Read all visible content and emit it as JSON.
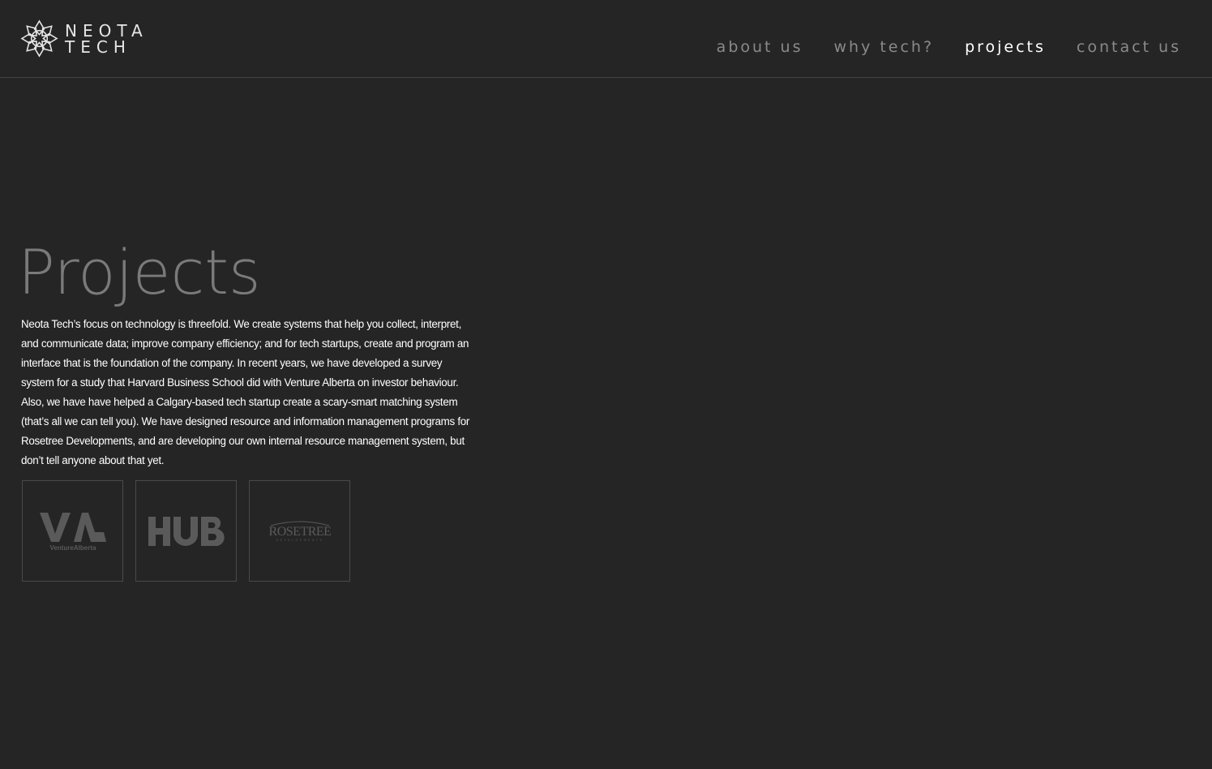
{
  "brand": {
    "name_line1": "NEOTA",
    "name_line2": "TECH"
  },
  "nav": {
    "items": [
      {
        "label": "about us",
        "active": false
      },
      {
        "label": "why tech?",
        "active": false
      },
      {
        "label": "projects",
        "active": true
      },
      {
        "label": "contact us",
        "active": false
      }
    ]
  },
  "main": {
    "title": "Projects",
    "intro": "Neota Tech’s focus on technology is threefold. We create systems that help you collect, interpret, and communicate data; improve company efficiency; and for tech startups, create and program an interface that is the foundation of the company. In recent years, we have developed a survey system for a study that Harvard Business School did with Venture Alberta on investor behaviour. Also, we have have helped a Calgary-based tech startup create a scary-smart matching system (that’s all we can tell you). We have designed resource and information management programs for Rosetree Developments, and are developing our own internal resource management system, but don’t tell anyone about that yet."
  },
  "projects": [
    {
      "name": "VA",
      "caption": "VentureAlberta",
      "icon": "venture-alberta-logo"
    },
    {
      "name": "HUB",
      "icon": "hub-logo"
    },
    {
      "name": "ROSETREE",
      "caption": "DEVELOPMENTS",
      "icon": "rosetree-logo"
    }
  ],
  "colors": {
    "background": "#252525",
    "nav_inactive": "#8a8a8a",
    "nav_active": "#ffffff",
    "title": "#7a7a7a",
    "logo_grey": "#5a5a5a",
    "border": "#444444"
  }
}
